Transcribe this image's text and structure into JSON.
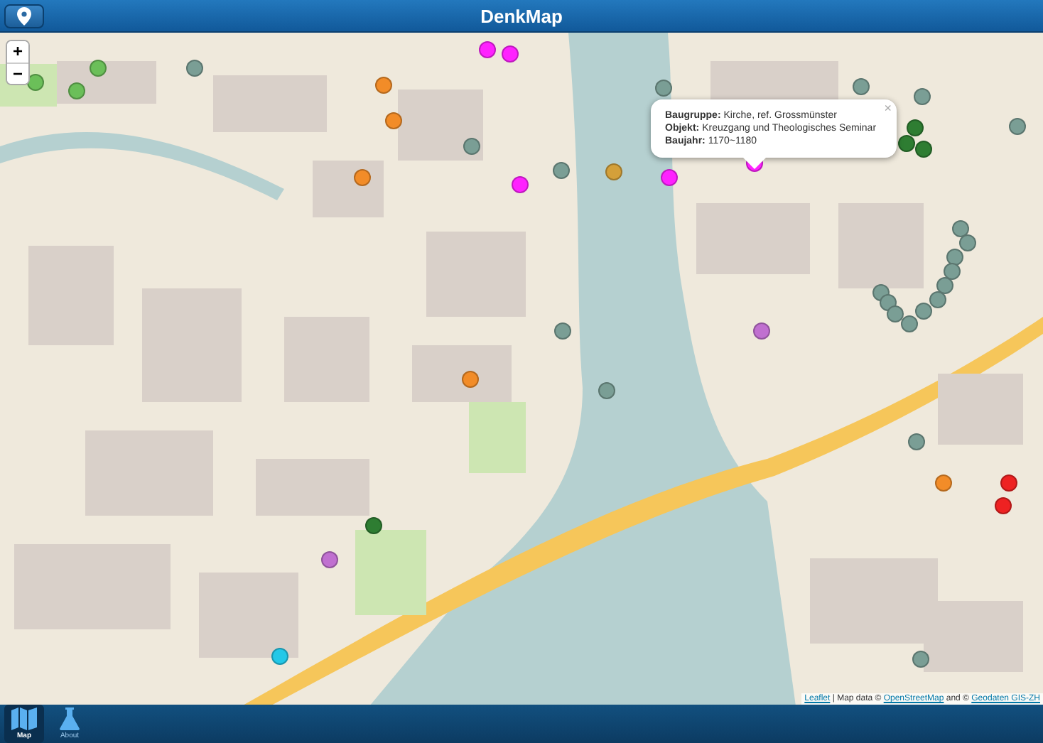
{
  "header": {
    "title": "DenkMap"
  },
  "zoom_controls": [
    "+",
    "−"
  ],
  "popup": {
    "close": "×",
    "lines": [
      "**Baugruppe:** Kirche, ref. Grossmünster",
      "**Objekt:** Kreuzgang und Theologisches Seminar",
      "**Baujahr:** 1170~1180"
    ]
  },
  "markers": [
    {
      "color": "#ff22ff"
    },
    {
      "color": "#ff22ff"
    },
    {
      "color": "#ff22ff"
    },
    {
      "color": "#ff22ff"
    },
    {
      "color": "#ff22ff"
    },
    {
      "color": "#7a9e95"
    },
    {
      "color": "#7a9e95"
    },
    {
      "color": "#7a9e95"
    },
    {
      "color": "#7a9e95"
    },
    {
      "color": "#7a9e95"
    },
    {
      "color": "#7a9e95"
    },
    {
      "color": "#7a9e95"
    },
    {
      "color": "#7a9e95"
    },
    {
      "color": "#7a9e95"
    },
    {
      "color": "#7a9e95"
    },
    {
      "color": "#7a9e95"
    },
    {
      "color": "#7a9e95"
    },
    {
      "color": "#7a9e95"
    },
    {
      "color": "#7a9e95"
    },
    {
      "color": "#7a9e95"
    },
    {
      "color": "#7a9e95"
    },
    {
      "color": "#7a9e95"
    },
    {
      "color": "#7a9e95"
    },
    {
      "color": "#7a9e95"
    },
    {
      "color": "#7a9e95"
    },
    {
      "color": "#7a9e95"
    },
    {
      "color": "#7a9e95"
    },
    {
      "color": "#6bbf59"
    },
    {
      "color": "#6bbf59"
    },
    {
      "color": "#6bbf59"
    },
    {
      "color": "#f28c28"
    },
    {
      "color": "#f28c28"
    },
    {
      "color": "#f28c28"
    },
    {
      "color": "#f28c28"
    },
    {
      "color": "#f28c28"
    },
    {
      "color": "#d4a03a"
    },
    {
      "color": "#2e7d32"
    },
    {
      "color": "#2e7d32"
    },
    {
      "color": "#2e7d32"
    },
    {
      "color": "#2e7d32"
    },
    {
      "color": "#c070d0"
    },
    {
      "color": "#c070d0"
    },
    {
      "color": "#ee2222"
    },
    {
      "color": "#ee2222"
    },
    {
      "color": "#22c8e8"
    }
  ],
  "attribution": {
    "parts": [
      {
        "kind": "link",
        "text": "Leaflet"
      },
      {
        "kind": "text",
        "text": " | Map data © "
      },
      {
        "kind": "link",
        "text": "OpenStreetMap"
      },
      {
        "kind": "text",
        "text": " and © "
      },
      {
        "kind": "link",
        "text": "Geodaten GIS-ZH"
      }
    ]
  },
  "tabs": [
    {
      "label": "Map",
      "selected": true
    },
    {
      "label": "About",
      "selected": false
    }
  ]
}
